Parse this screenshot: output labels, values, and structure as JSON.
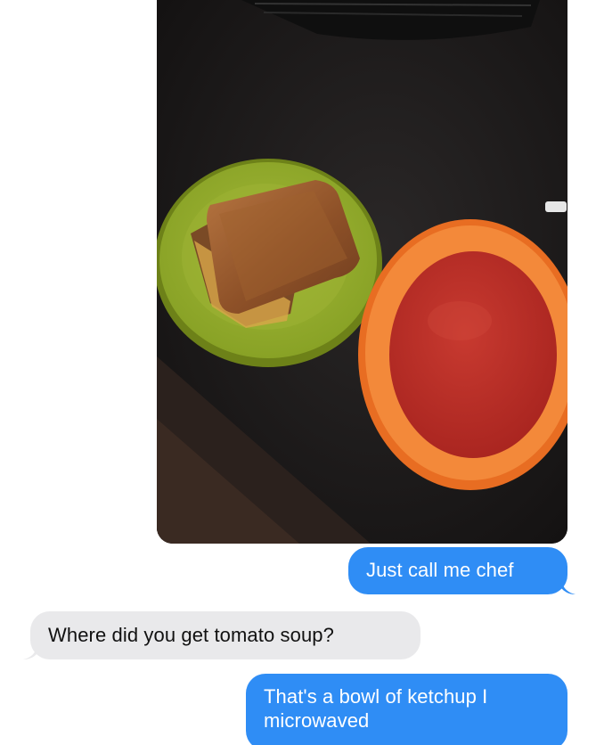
{
  "conversation": {
    "photo": {
      "icon": "photo-message",
      "colors": {
        "table": "#1c1a1a",
        "plate": "#97ad2b",
        "bowl": "#f07a2a",
        "soup": "#c0302a",
        "toast": "#9a5a2c"
      }
    },
    "messages": [
      {
        "side": "sent",
        "text": "Just call me chef"
      },
      {
        "side": "received",
        "text": "Where did you get tomato soup?"
      },
      {
        "side": "sent",
        "text": "That's a bowl of ketchup I microwaved"
      }
    ],
    "colors": {
      "sent_bubble": "#2f8df5",
      "received_bubble": "#e9e9eb",
      "background": "#ffffff"
    }
  }
}
